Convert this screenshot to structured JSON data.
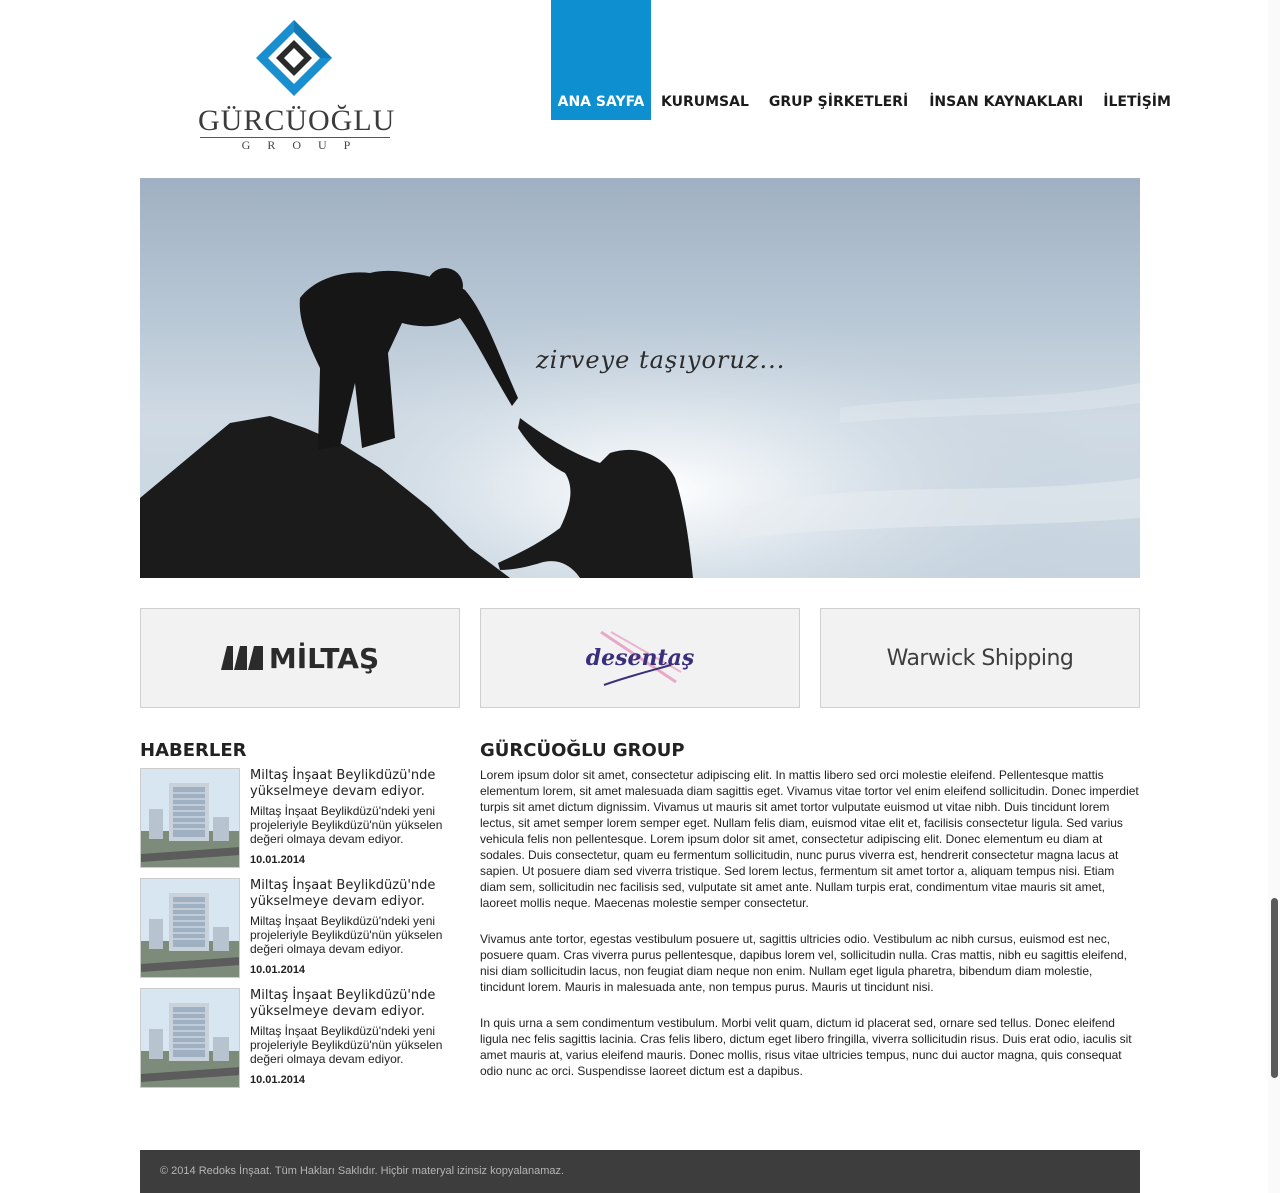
{
  "brand": {
    "name": "GÜRCÜOĞLU",
    "sub": "GROUP",
    "logo_color": "#1a8fd0"
  },
  "nav": {
    "items": [
      "ANA SAYFA",
      "KURUMSAL",
      "GRUP ŞİRKETLERİ",
      "İNSAN KAYNAKLARI",
      "İLETİŞİM"
    ],
    "active_index": 0,
    "active_color": "#0e8fcf"
  },
  "hero": {
    "tagline": "zirveye taşıyoruz..."
  },
  "partners": [
    {
      "name": "MİLTAŞ"
    },
    {
      "name": "desentaş"
    },
    {
      "name": "Warwick Shipping"
    }
  ],
  "news": {
    "title": "HABERLER",
    "items": [
      {
        "headline": "Miltaş İnşaat Beylikdüzü'nde yükselmeye devam ediyor.",
        "summary": "Miltaş İnşaat Beylikdüzü'ndeki yeni projeleriyle Beylikdüzü'nün yükselen değeri olmaya devam ediyor.",
        "date": "10.01.2014"
      },
      {
        "headline": "Miltaş İnşaat Beylikdüzü'nde yükselmeye devam ediyor.",
        "summary": "Miltaş İnşaat Beylikdüzü'ndeki yeni projeleriyle Beylikdüzü'nün yükselen değeri olmaya devam ediyor.",
        "date": "10.01.2014"
      },
      {
        "headline": "Miltaş İnşaat Beylikdüzü'nde yükselmeye devam ediyor.",
        "summary": "Miltaş İnşaat Beylikdüzü'ndeki yeni projeleriyle Beylikdüzü'nün yükselen değeri olmaya devam ediyor.",
        "date": "10.01.2014"
      }
    ]
  },
  "about": {
    "title": "GÜRCÜOĞLU GROUP",
    "paragraphs": [
      "Lorem ipsum dolor sit amet, consectetur adipiscing elit. In mattis libero sed orci molestie eleifend. Pellentesque mattis elementum lorem, sit amet malesuada diam sagittis eget. Vivamus vitae tortor vel enim eleifend sollicitudin. Donec imperdiet turpis sit amet dictum dignissim. Vivamus ut mauris sit amet tortor vulputate euismod ut vitae nibh. Duis tincidunt lorem lectus, sit amet semper lorem semper eget. Nullam felis diam, euismod vitae elit et, facilisis consectetur ligula. Sed varius vehicula felis non pellentesque. Lorem ipsum dolor sit amet, consectetur adipiscing elit. Donec elementum eu diam at sodales. Duis consectetur, quam eu fermentum sollicitudin, nunc purus viverra est, hendrerit consectetur magna lacus at sapien. Ut posuere diam sed viverra tristique. Sed lorem lectus, fermentum sit amet tortor a, aliquam tempus nisi. Etiam diam sem, sollicitudin nec facilisis sed, vulputate sit amet ante. Nullam turpis erat, condimentum vitae mauris sit amet, laoreet mollis neque. Maecenas molestie semper consectetur.",
      "Vivamus ante tortor, egestas vestibulum posuere ut, sagittis ultricies odio. Vestibulum ac nibh cursus, euismod est nec, posuere quam. Cras viverra purus pellentesque, dapibus lorem vel, sollicitudin nulla. Cras mattis, nibh eu sagittis eleifend, nisi diam sollicitudin lacus, non feugiat diam neque non enim. Nullam eget ligula pharetra, bibendum diam molestie, tincidunt lorem. Mauris in malesuada ante, non tempus purus. Mauris ut tincidunt nisi.",
      "In quis urna a sem condimentum vestibulum. Morbi velit quam, dictum id placerat sed, ornare sed tellus. Donec eleifend ligula nec felis sagittis lacinia. Cras felis libero, dictum eget libero fringilla, viverra sollicitudin risus. Duis erat odio, iaculis sit amet mauris at, varius eleifend mauris. Donec mollis, risus vitae ultricies tempus, nunc dui auctor magna, quis consequat odio nunc ac orci. Suspendisse laoreet dictum est a dapibus."
    ]
  },
  "footer": {
    "copyright": "© 2014 Redoks İnşaat. Tüm Hakları Saklıdır. Hiçbir materyal izinsiz kopyalanamaz."
  }
}
